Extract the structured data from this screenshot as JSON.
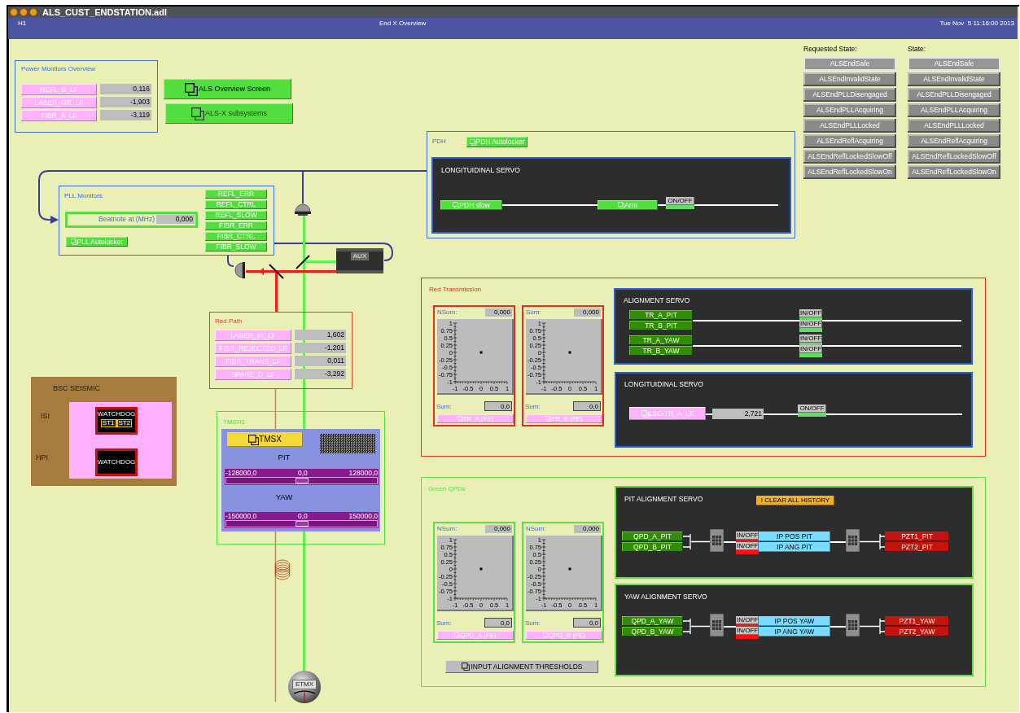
{
  "window": {
    "title": "ALS_CUST_ENDSTATION.adl"
  },
  "header": {
    "site": "H1",
    "title": "End X Overview",
    "datetime": "Tue Nov  5 11:16:00 2013"
  },
  "power_monitors": {
    "title": "Power Monitors Overview",
    "rows": [
      {
        "label": "REFL_B_LF",
        "value": "0,116"
      },
      {
        "label": "LASER_GR_LF",
        "value": "-1,903"
      },
      {
        "label": "FIBR_A_LF",
        "value": "-3,119"
      }
    ]
  },
  "screen_links": [
    {
      "label": "ALS Overview Screen"
    },
    {
      "label": "ALS-X subsystems"
    }
  ],
  "requested_state": {
    "title": "Requested State:",
    "options": [
      {
        "label": "ALSEndSafe",
        "selected": true
      },
      {
        "label": "ALSEndInvalidState",
        "selected": false
      },
      {
        "label": "ALSEndPLLDisengaged",
        "selected": false
      },
      {
        "label": "ALSEndPLLAcquiring",
        "selected": false
      },
      {
        "label": "ALSEndPLLLocked",
        "selected": false
      },
      {
        "label": "ALSEndReflAcquiring",
        "selected": false
      },
      {
        "label": "ALSEndReflLockedSlowOff",
        "selected": false
      },
      {
        "label": "ALSEndReflLockedSlowOn",
        "selected": false
      }
    ]
  },
  "state": {
    "title": "State:",
    "options": [
      {
        "label": "ALSEndSafe",
        "selected": true
      },
      {
        "label": "ALSEndInvalidState",
        "selected": false
      },
      {
        "label": "ALSEndPLLDisengaged",
        "selected": false
      },
      {
        "label": "ALSEndPLLAcquiring",
        "selected": false
      },
      {
        "label": "ALSEndPLLLocked",
        "selected": false
      },
      {
        "label": "ALSEndReflAcquiring",
        "selected": false
      },
      {
        "label": "ALSEndReflLockedSlowOff",
        "selected": false
      },
      {
        "label": "ALSEndReflLockedSlowOn",
        "selected": false
      }
    ]
  },
  "pdh": {
    "title": "PDH",
    "autolocker": "PDH Autolocker",
    "servo": {
      "title": "LONGITUIDINAL SERVO",
      "buttons": [
        "PDH slow",
        "Arm"
      ],
      "toggle": {
        "label": "ON/OFF",
        "on": true
      }
    }
  },
  "pll": {
    "title": "PLL Monitors",
    "beatnote": {
      "label": "Beatnote at (MHz)",
      "value": "0,000"
    },
    "autolocker": "PLL Autolocker",
    "signals": [
      "REFL_ERR",
      "REFL_CTRL",
      "REFL_SLOW",
      "FIBR_ERR",
      "FIBR_CTRL",
      "FIBR_SLOW"
    ]
  },
  "aux_laser": {
    "label": "AUX"
  },
  "red_path": {
    "title": "Red Path",
    "rows": [
      {
        "label": "LASER_IR_LF",
        "value": "1,602"
      },
      {
        "label": "FIBR_REJECTED_LF",
        "value": "-1,201"
      },
      {
        "label": "FIBR_TRANS_LF",
        "value": "0,011"
      },
      {
        "label": "SPARE_D_LF",
        "value": "-3,292"
      }
    ]
  },
  "seismic": {
    "title": "BSC SEISMIC",
    "isi": {
      "label": "ISI",
      "watchdog": "WATCHDOG",
      "stages": [
        "ST1",
        "ST2"
      ]
    },
    "hpi": {
      "label": "HPI",
      "watchdog": "WATCHDOG"
    }
  },
  "tms": {
    "title": "TMSH1",
    "button": "TMSX",
    "sliders": [
      {
        "label": "PIT",
        "min": "-128000,0",
        "center": "0,0",
        "max": "128000,0",
        "level": 0.5
      },
      {
        "label": "YAW",
        "min": "-150000,0",
        "center": "0,0",
        "max": "150000,0",
        "level": 0.5
      }
    ]
  },
  "etm": {
    "label": "ETMX"
  },
  "red_transmission": {
    "title": "Red Transmission",
    "qpds": [
      {
        "top_label": "NSum:",
        "top_value": "0,000",
        "sum_label": "Sum:",
        "sum_value": "0,0",
        "button": "TR_A (FE)",
        "chart_data": {
          "type": "scatter",
          "x": [
            0
          ],
          "values": [
            0
          ],
          "xlim": [
            -1,
            1
          ],
          "ylim": [
            -1,
            1
          ],
          "xticks": [
            -1,
            -0.5,
            0,
            0.5,
            1
          ],
          "yticks": [
            -1,
            -0.75,
            -0.5,
            -0.25,
            0,
            0.25,
            0.5,
            0.75,
            1
          ]
        }
      },
      {
        "top_label": "Sum:",
        "top_value": "0,000",
        "sum_label": "Sum:",
        "sum_value": "0,0",
        "button": "TR_B (FE)",
        "chart_data": {
          "type": "scatter",
          "x": [
            0
          ],
          "values": [
            0
          ],
          "xlim": [
            -1,
            1
          ],
          "ylim": [
            -1,
            1
          ],
          "xticks": [
            -1,
            -0.5,
            0,
            0.5,
            1
          ],
          "yticks": [
            -1,
            -0.75,
            -0.5,
            -0.25,
            0,
            0.25,
            0.5,
            0.75,
            1
          ]
        }
      }
    ],
    "alignment_servo": {
      "title": "ALIGNMENT SERVO",
      "rows": [
        {
          "label": "TR_A_PIT",
          "toggle": "IN/OFF",
          "on": true
        },
        {
          "label": "TR_B_PIT",
          "toggle": "IN/OFF",
          "on": true
        },
        {
          "label": "TR_A_YAW",
          "toggle": "IN/OFF",
          "on": true
        },
        {
          "label": "TR_B_YAW",
          "toggle": "IN/OFF",
          "on": true
        }
      ]
    },
    "longitudinal_servo": {
      "title": "LONGITUIDINAL SERVO",
      "button": "LSC-TR_A_LF",
      "value": "2,721",
      "toggle": {
        "label": "ON/OFF",
        "on": true
      }
    }
  },
  "green_qpds": {
    "title": "Green QPDs",
    "qpds": [
      {
        "top_label": "NSum:",
        "top_value": "0,000",
        "sum_label": "Sum:",
        "sum_value": "0,0",
        "button": "QPD_A (FE)",
        "chart_data": {
          "type": "scatter",
          "x": [
            0
          ],
          "values": [
            0
          ],
          "xlim": [
            -1,
            1
          ],
          "ylim": [
            -1,
            1
          ],
          "xticks": [
            -1,
            -0.5,
            0,
            0.5,
            1
          ],
          "yticks": [
            -1,
            -0.75,
            -0.5,
            -0.25,
            0,
            0.25,
            0.5,
            0.75,
            1
          ]
        }
      },
      {
        "top_label": "NSum:",
        "top_value": "0,000",
        "sum_label": "Sum:",
        "sum_value": "0,0",
        "button": "QPD_B (FE)",
        "chart_data": {
          "type": "scatter",
          "x": [
            0
          ],
          "values": [
            0
          ],
          "xlim": [
            -1,
            1
          ],
          "ylim": [
            -1,
            1
          ],
          "xticks": [
            -1,
            -0.5,
            0,
            0.5,
            1
          ],
          "yticks": [
            -1,
            -0.75,
            -0.5,
            -0.25,
            0,
            0.25,
            0.5,
            0.75,
            1
          ]
        }
      }
    ],
    "thresholds_button": "INPUT ALIGNMENT THRESHOLDS",
    "servos": [
      {
        "title": "PIT ALIGNMENT SERVO",
        "clear_button": "! CLEAR ALL HISTORY",
        "rows": [
          {
            "input": "QPD_A_PIT",
            "toggle": "IN/OFF",
            "on": false,
            "output": "IP POS PIT",
            "actuator": "PZT1_PIT"
          },
          {
            "input": "QPD_B_PIT",
            "toggle": "IN/OFF",
            "on": false,
            "output": "IP ANG PIT",
            "actuator": "PZT2_PIT"
          }
        ]
      },
      {
        "title": "YAW ALIGNMENT SERVO",
        "rows": [
          {
            "input": "QPD_A_YAW",
            "toggle": "IN/OFF",
            "on": false,
            "output": "IP POS YAW",
            "actuator": "PZT1_YAW"
          },
          {
            "input": "QPD_B_YAW",
            "toggle": "IN/OFF",
            "on": false,
            "output": "IP ANG YAW",
            "actuator": "PZT2_YAW"
          }
        ]
      }
    ]
  }
}
